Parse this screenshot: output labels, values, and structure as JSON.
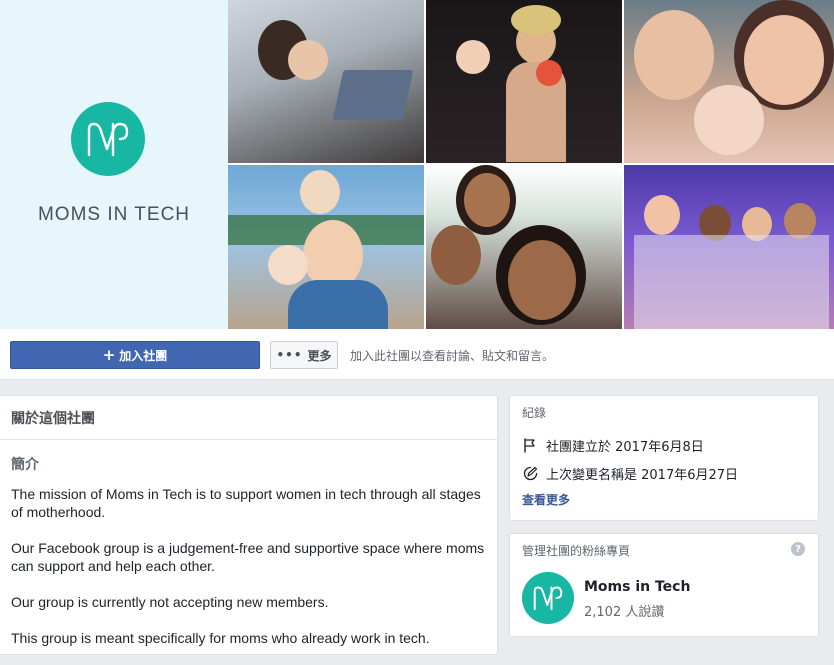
{
  "cover": {
    "brand_name": "MOMS IN TECH",
    "brand_color": "#17b7a4",
    "brand_bg": "#e6f6fa",
    "photos": [
      "mom-with-laptop",
      "mom-holding-baby-on-stage",
      "selfie-with-baby",
      "mom-with-kids-outdoors",
      "family-selfie",
      "group-of-women"
    ]
  },
  "actions": {
    "join_icon": "plus-icon",
    "join_label": "加入社團",
    "more_icon": "ellipsis-icon",
    "more_label": "更多",
    "join_hint": "加入此社團以查看討論、貼文和留言。"
  },
  "about": {
    "title": "關於這個社團",
    "subtitle": "簡介",
    "paragraphs": [
      "The mission of Moms in Tech is to support women in tech through all stages of motherhood.",
      "Our Facebook group is a judgement-free and supportive space where moms can support and help each other.",
      "Our group is currently not accepting new members.",
      "This group is meant specifically for moms who already work in tech."
    ]
  },
  "record": {
    "heading": "紀錄",
    "created_icon": "flag-icon",
    "created": "社團建立於 2017年6月8日",
    "renamed_icon": "edit-icon",
    "renamed": "上次變更名稱是 2017年6月27日",
    "see_more": "查看更多"
  },
  "managed_page": {
    "heading": "管理社團的粉絲專頁",
    "help_icon": "question-icon",
    "help_glyph": "?",
    "name": "Moms in Tech",
    "likes": "2,102 人說讚"
  },
  "colors": {
    "primary": "#4267b2",
    "link": "#385898",
    "page_bg": "#e9ebee"
  }
}
